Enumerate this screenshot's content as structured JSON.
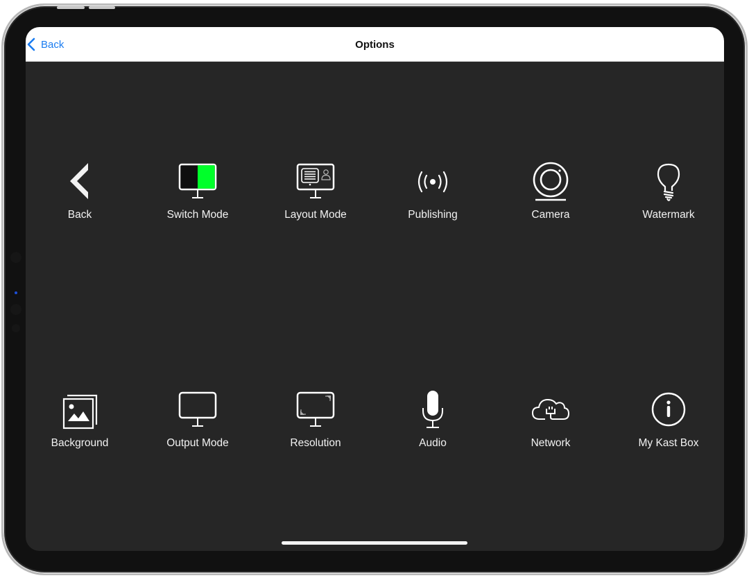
{
  "navbar": {
    "back_label": "Back",
    "title": "Options",
    "accent_color": "#1a7cf0"
  },
  "options": [
    {
      "id": "back",
      "label": "Back",
      "icon": "chevron-left-icon"
    },
    {
      "id": "switch-mode",
      "label": "Switch Mode",
      "icon": "monitor-split-icon",
      "accent": "#00ff2a"
    },
    {
      "id": "layout-mode",
      "label": "Layout Mode",
      "icon": "monitor-layout-icon"
    },
    {
      "id": "publishing",
      "label": "Publishing",
      "icon": "broadcast-icon"
    },
    {
      "id": "camera",
      "label": "Camera",
      "icon": "webcam-icon"
    },
    {
      "id": "watermark",
      "label": "Watermark",
      "icon": "lightbulb-icon"
    },
    {
      "id": "background",
      "label": "Background",
      "icon": "image-stack-icon"
    },
    {
      "id": "output-mode",
      "label": "Output Mode",
      "icon": "monitor-icon"
    },
    {
      "id": "resolution",
      "label": "Resolution",
      "icon": "monitor-resize-icon"
    },
    {
      "id": "audio",
      "label": "Audio",
      "icon": "microphone-icon"
    },
    {
      "id": "network",
      "label": "Network",
      "icon": "cloud-plug-icon"
    },
    {
      "id": "my-kast-box",
      "label": "My Kast Box",
      "icon": "info-circle-icon"
    }
  ]
}
